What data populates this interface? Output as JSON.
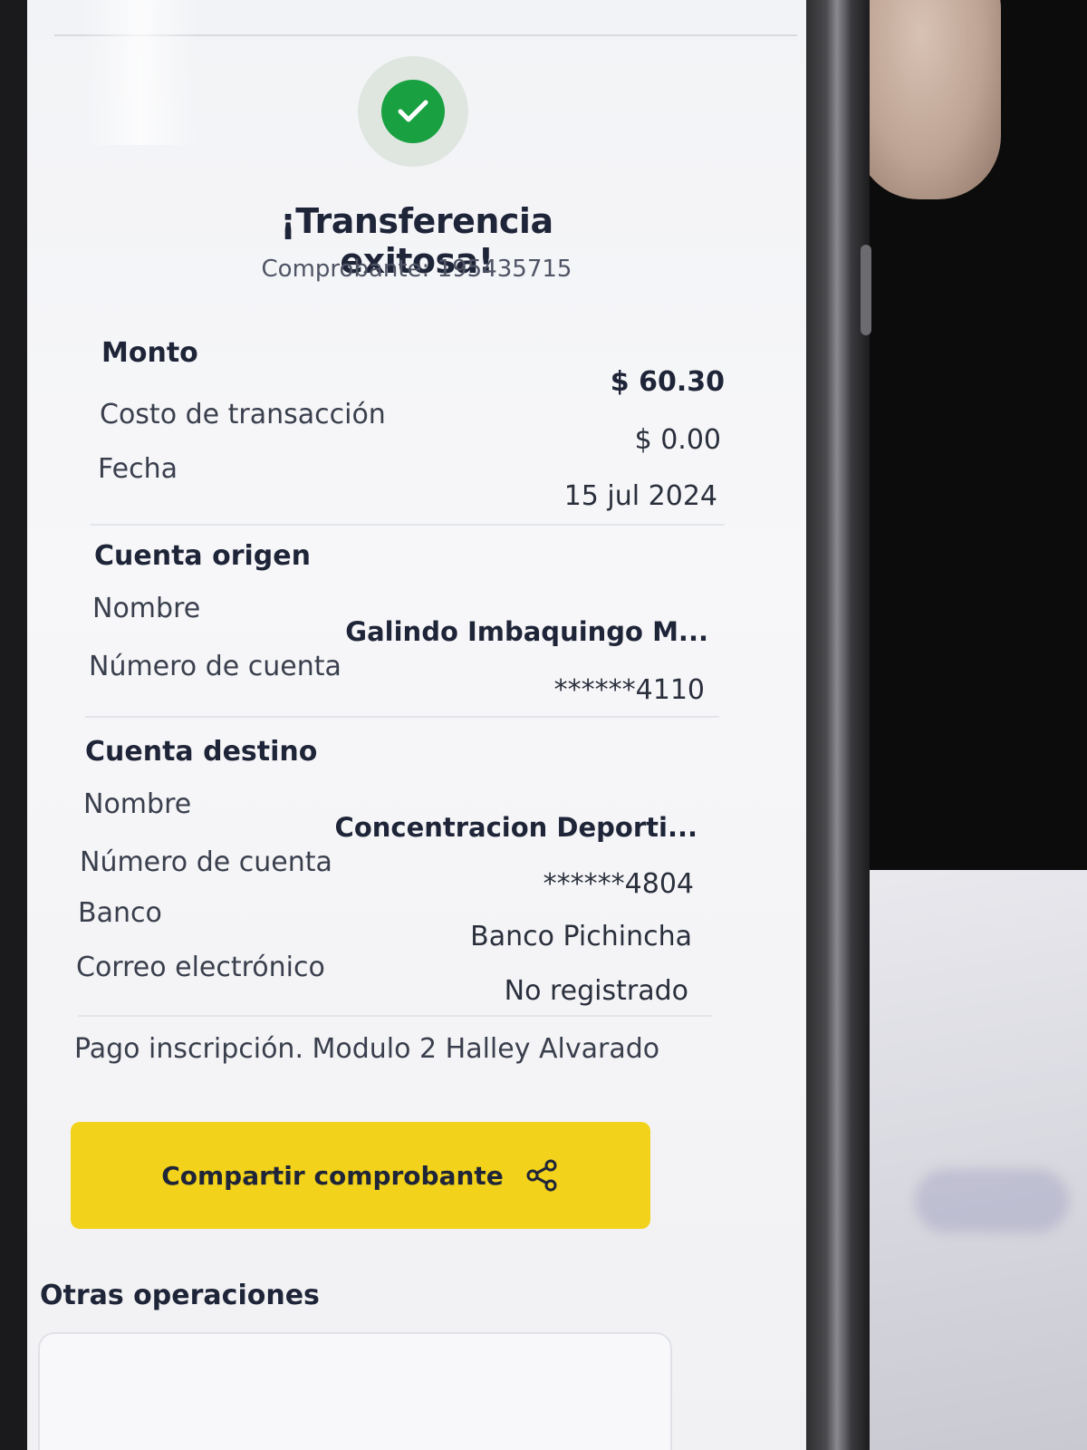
{
  "header": {
    "title": "¡Transferencia exitosa!",
    "receipt": "Comprobante: 195435715"
  },
  "summary": {
    "amount_label": "Monto",
    "amount_value": "$ 60.30",
    "cost_label": "Costo de transacción",
    "cost_value": "$ 0.00",
    "date_label": "Fecha",
    "date_value": "15 jul 2024"
  },
  "origin": {
    "section_title": "Cuenta origen",
    "name_label": "Nombre",
    "name_value": "Galindo  Imbaquingo M...",
    "account_label": "Número de cuenta",
    "account_value": "******4110"
  },
  "destination": {
    "section_title": "Cuenta destino",
    "name_label": "Nombre",
    "name_value": "Concentracion Deporti...",
    "account_label": "Número de cuenta",
    "account_value": "******4804",
    "bank_label": "Banco",
    "bank_value": "Banco Pichincha",
    "email_label": "Correo electrónico",
    "email_value": "No registrado"
  },
  "note": "Pago inscripción. Modulo 2 Halley Alvarado",
  "share_button": {
    "label": "Compartir comprobante",
    "icon": "share-icon"
  },
  "other_operations": {
    "title": "Otras operaciones"
  },
  "colors": {
    "success_green": "#19a141",
    "button_yellow": "#f2d21b",
    "text_dark": "#1f2538"
  }
}
